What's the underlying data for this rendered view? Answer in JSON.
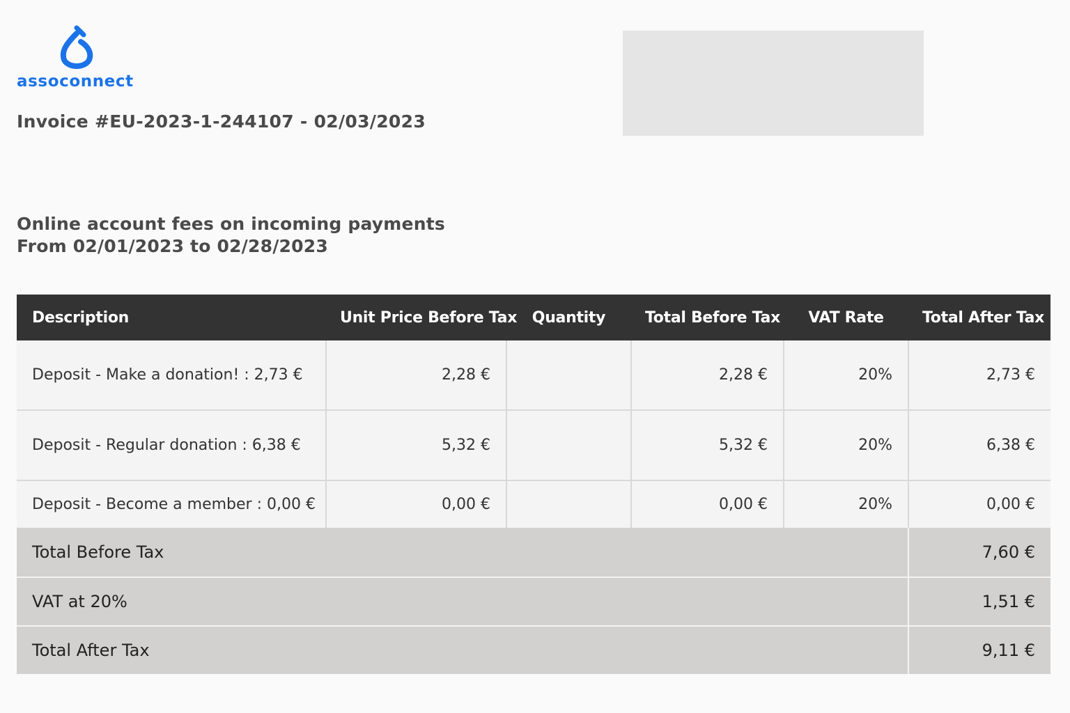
{
  "brand": {
    "name": "assoconnect",
    "color": "#1a73e8"
  },
  "invoice": {
    "title": "Invoice #EU-2023-1-244107 - 02/03/2023"
  },
  "subtitle": {
    "line1": "Online account fees on incoming payments",
    "line2": "From 02/01/2023 to 02/28/2023"
  },
  "table": {
    "headers": {
      "description": "Description",
      "unit_price": "Unit Price Before Tax",
      "quantity": "Quantity",
      "total_before_tax": "Total Before Tax",
      "vat_rate": "VAT Rate",
      "total_after_tax": "Total After Tax"
    },
    "rows": [
      {
        "description": "Deposit - Make a donation! : 2,73 €",
        "unit_price": "2,28 €",
        "quantity": "",
        "total_before_tax": "2,28 €",
        "vat_rate": "20%",
        "total_after_tax": "2,73 €"
      },
      {
        "description": "Deposit - Regular donation : 6,38 €",
        "unit_price": "5,32 €",
        "quantity": "",
        "total_before_tax": "5,32 €",
        "vat_rate": "20%",
        "total_after_tax": "6,38 €"
      },
      {
        "description": "Deposit - Become a member : 0,00 €",
        "unit_price": "0,00 €",
        "quantity": "",
        "total_before_tax": "0,00 €",
        "vat_rate": "20%",
        "total_after_tax": "0,00 €"
      }
    ],
    "totals": [
      {
        "label": "Total Before Tax",
        "value": "7,60 €"
      },
      {
        "label": "VAT at 20%",
        "value": "1,51 €"
      },
      {
        "label": "Total After Tax",
        "value": "9,11 €"
      }
    ]
  }
}
